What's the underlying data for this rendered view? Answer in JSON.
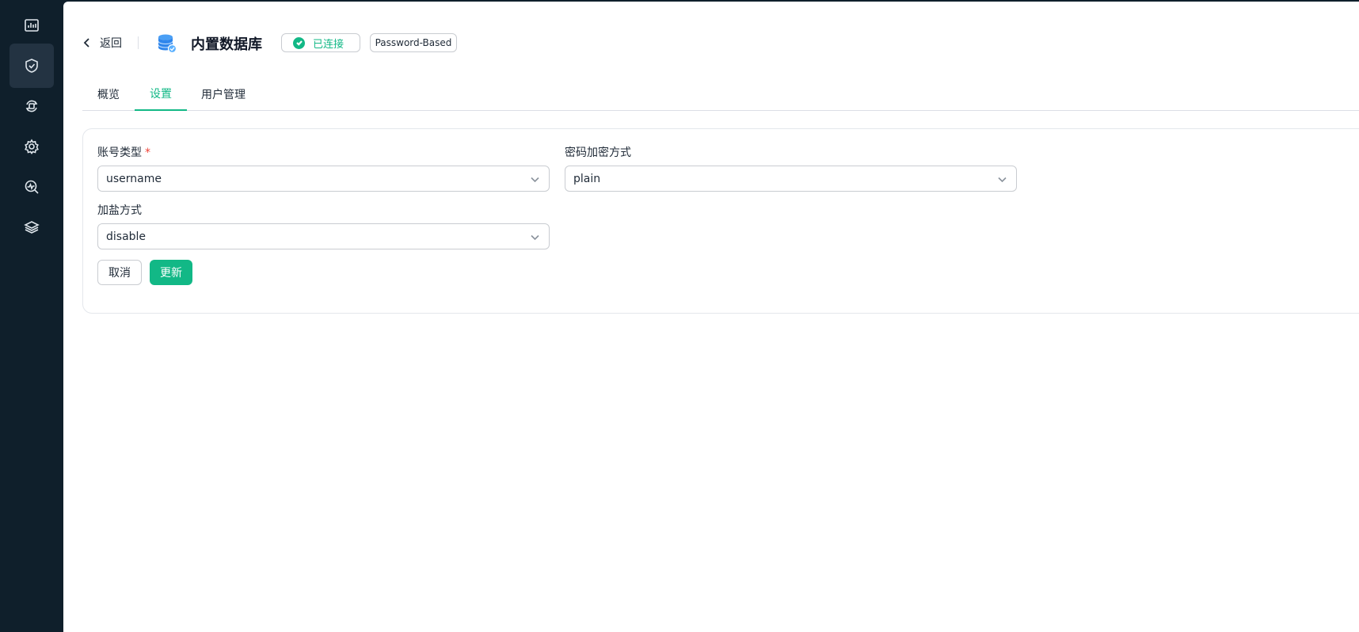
{
  "sidebar": {
    "items": [
      {
        "icon": "dashboard-icon",
        "active": false
      },
      {
        "icon": "shield-icon",
        "active": true
      },
      {
        "icon": "sync-icon",
        "active": false
      },
      {
        "icon": "gear-icon",
        "active": false
      },
      {
        "icon": "monitor-search-icon",
        "active": false
      },
      {
        "icon": "layers-icon",
        "active": false
      }
    ]
  },
  "header": {
    "back_label": "返回",
    "title": "内置数据库",
    "status_label": "已连接",
    "auth_label": "Password-Based"
  },
  "tabs": [
    {
      "label": "概览",
      "active": false
    },
    {
      "label": "设置",
      "active": true
    },
    {
      "label": "用户管理",
      "active": false
    }
  ],
  "form": {
    "account_type": {
      "label": "账号类型",
      "required": "*",
      "value": "username"
    },
    "password_encryption": {
      "label": "密码加密方式",
      "value": "plain"
    },
    "salt_method": {
      "label": "加盐方式",
      "value": "disable"
    },
    "cancel_label": "取消",
    "update_label": "更新"
  },
  "colors": {
    "accent": "#12b886",
    "sidebar_bg": "#0f1f2b",
    "sidebar_active": "#233342",
    "required": "#f04438"
  }
}
